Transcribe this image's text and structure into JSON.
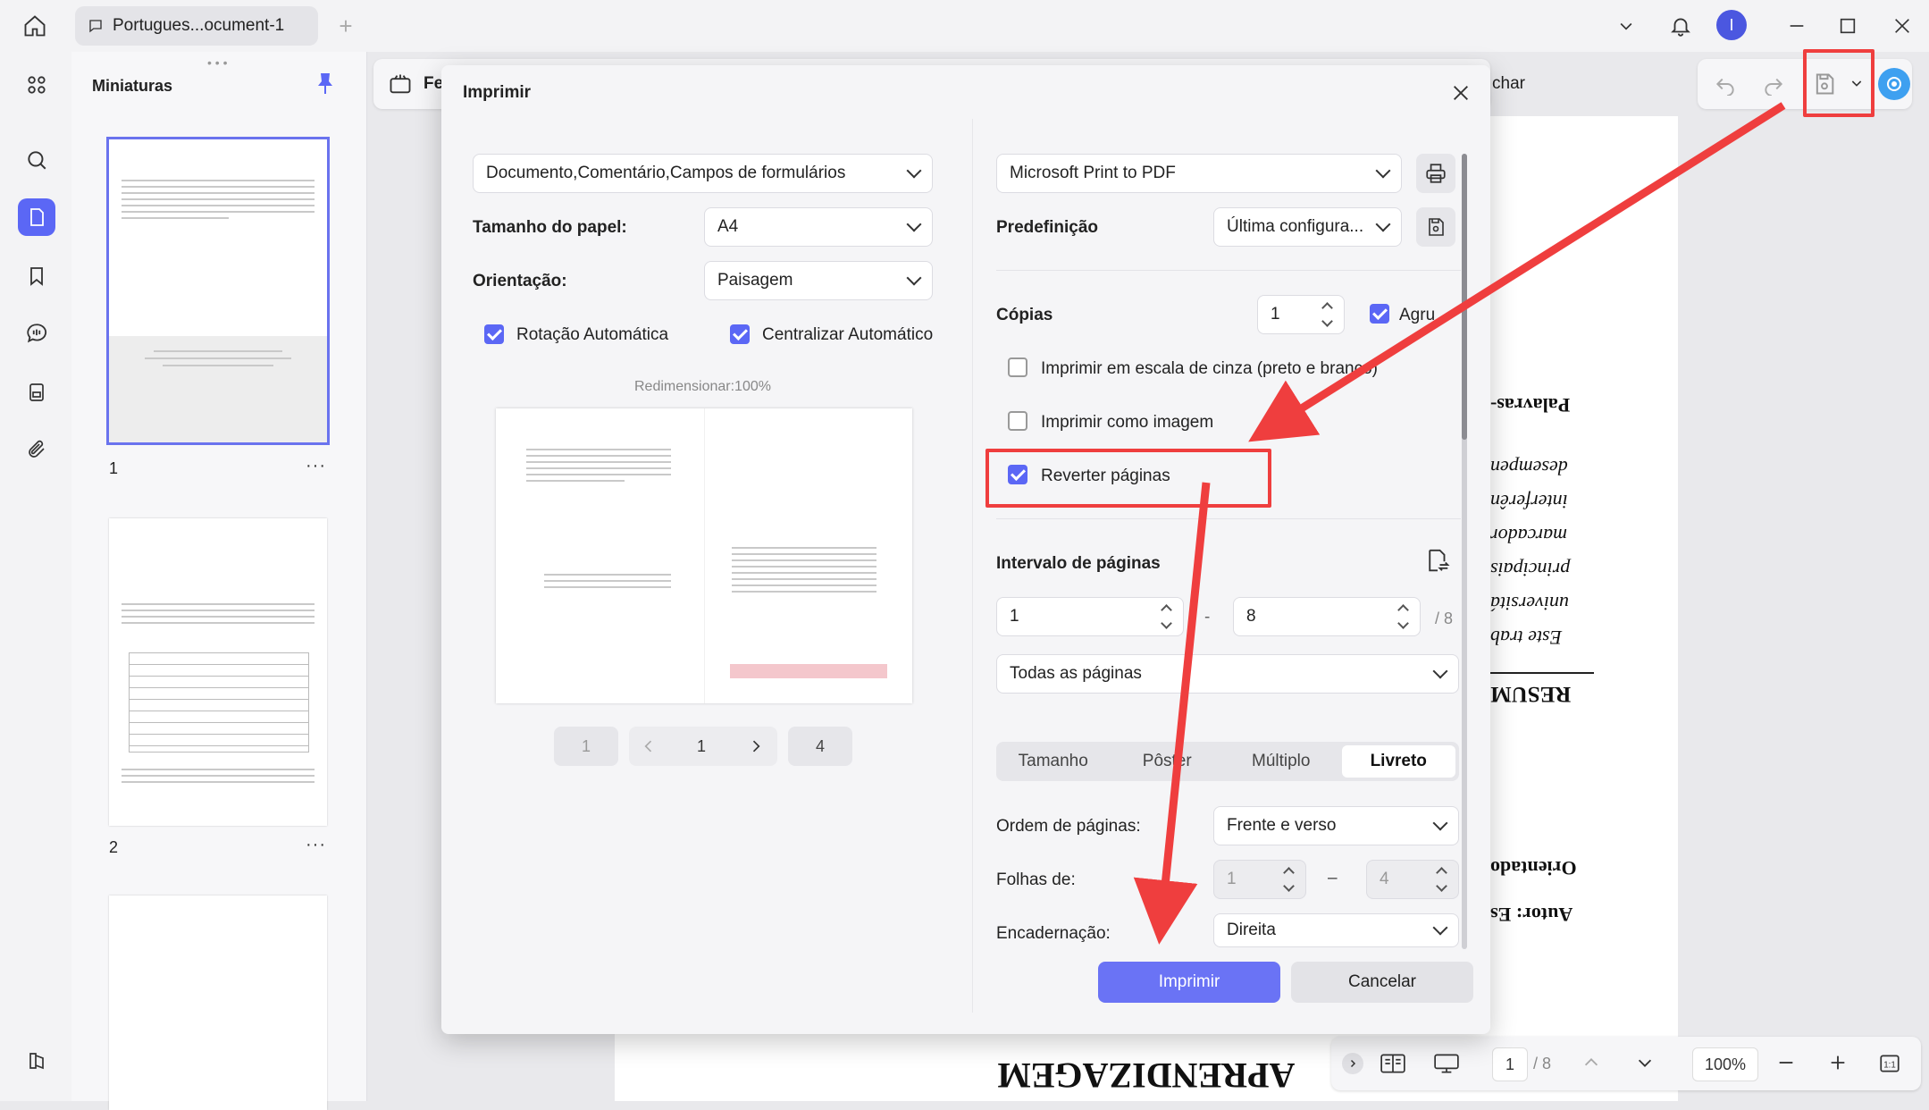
{
  "titlebar": {
    "tab_label": "Portugues...ocument-1",
    "avatar_initial": "I"
  },
  "thumbnails": {
    "title": "Miniaturas",
    "pages": [
      {
        "number": "1",
        "more": "···"
      },
      {
        "number": "2",
        "more": "···"
      }
    ]
  },
  "toolbar": {
    "left_fragment": "Fe",
    "right_fragment": "char"
  },
  "document": {
    "lines": [
      "Palavras-",
      "desempen",
      "interferên",
      "marcador",
      "principais",
      "universitá",
      "Este trab",
      "RESUM",
      "Orientado",
      "Autor: Es",
      "APRENDIZAGEM"
    ]
  },
  "bottom_bar": {
    "page": "1",
    "total": "/ 8",
    "zoom": "100%"
  },
  "dialog": {
    "title": "Imprimir",
    "content_select": "Documento,Comentário,Campos de formulários",
    "paper_size_label": "Tamanho do papel:",
    "paper_size_value": "A4",
    "orientation_label": "Orientação:",
    "orientation_value": "Paisagem",
    "auto_rotate_label": "Rotação Automática",
    "auto_center_label": "Centralizar Automático",
    "resize_label": "Redimensionar:100%",
    "preview_pager": {
      "first": "1",
      "current": "1",
      "last": "4"
    },
    "printer_value": "Microsoft Print to PDF",
    "preset_label": "Predefinição",
    "preset_value": "Última configura...",
    "copies_label": "Cópias",
    "copies_value": "1",
    "collate_label": "Agru",
    "grayscale_label": "Imprimir em escala de cinza (preto e branco)",
    "as_image_label": "Imprimir como imagem",
    "reverse_label": "Reverter páginas",
    "range_label": "Intervalo de páginas",
    "range_from": "1",
    "range_dash": "-",
    "range_to": "8",
    "range_total": "/ 8",
    "range_mode": "Todas as páginas",
    "tabs": [
      "Tamanho",
      "Pôster",
      "Múltiplo",
      "Livreto"
    ],
    "page_order_label": "Ordem de páginas:",
    "page_order_value": "Frente e verso",
    "sheets_label": "Folhas de:",
    "sheets_from": "1",
    "sheets_dash": "–",
    "sheets_to": "4",
    "binding_label": "Encadernação:",
    "binding_value": "Direita",
    "print_button": "Imprimir",
    "cancel_button": "Cancelar"
  },
  "colors": {
    "accent": "#5b67f5",
    "annotation": "#ef3e3e"
  }
}
